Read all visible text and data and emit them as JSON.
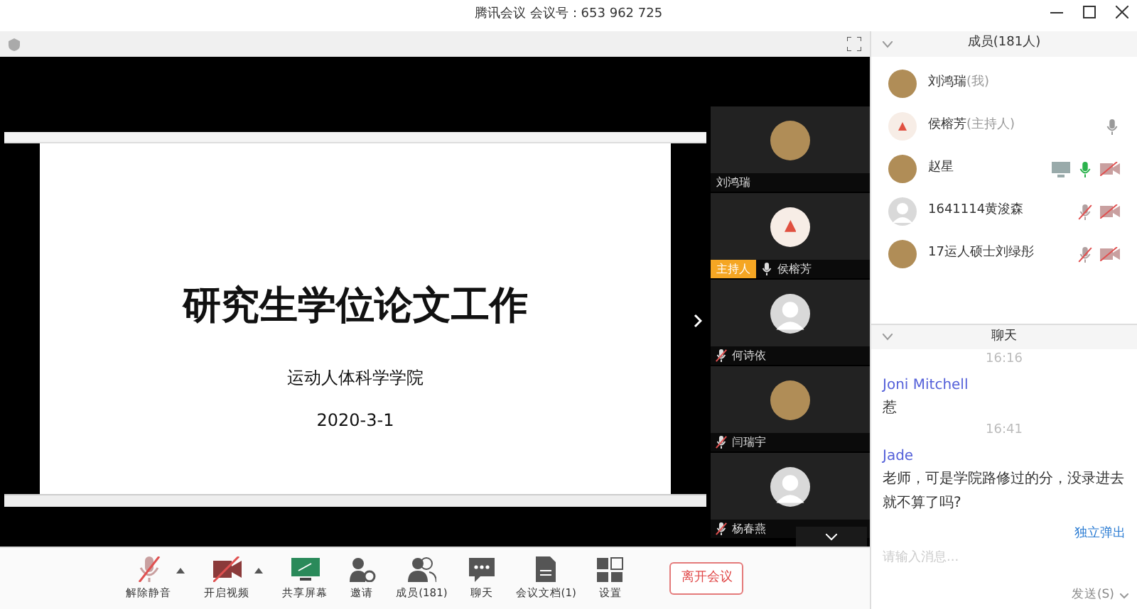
{
  "window": {
    "title": "腾讯会议 会议号：653 962 725"
  },
  "slide": {
    "title": "研究生学位论文工作",
    "subtitle": "运动人体科学学院",
    "date": "2020-3-1"
  },
  "video_tiles": [
    {
      "name": "刘鸿瑞",
      "avatar": {
        "kind": "photo"
      }
    },
    {
      "name": "侯榕芳",
      "avatar": {
        "kind": "mark"
      },
      "mic": {
        "kind": "idle"
      },
      "badge": "主持人"
    },
    {
      "name": "何诗依",
      "avatar": {
        "kind": "default"
      },
      "mic": {
        "kind": "muted"
      }
    },
    {
      "name": "闫瑞宇",
      "avatar": {
        "kind": "photo"
      },
      "mic": {
        "kind": "muted"
      }
    },
    {
      "name": "杨春燕",
      "avatar": {
        "kind": "default"
      },
      "mic": {
        "kind": "muted"
      }
    }
  ],
  "members": {
    "title": "成员(181人)",
    "items": [
      {
        "name": "刘鸿瑞",
        "tag": "(我)",
        "avatar": {
          "kind": "photo"
        },
        "sharing": false
      },
      {
        "name": "侯榕芳",
        "tag": "(主持人)",
        "avatar": {
          "kind": "mark"
        },
        "mic": {
          "kind": "idle"
        },
        "sharing": false
      },
      {
        "name": "赵星",
        "avatar": {
          "kind": "photo"
        },
        "mic": {
          "kind": "on"
        },
        "video_off": true,
        "sharing": true
      },
      {
        "name": "1641114黄浚森",
        "avatar": {
          "kind": "default"
        },
        "mic": {
          "kind": "muted"
        },
        "video_off": true,
        "sharing": false
      },
      {
        "name": "17运人硕士刘绿彤",
        "avatar": {
          "kind": "photo"
        },
        "mic": {
          "kind": "muted"
        },
        "video_off": true,
        "sharing": false
      }
    ]
  },
  "chat": {
    "title": "聊天",
    "messages": [
      {
        "kind": "time",
        "text": "16:16"
      },
      {
        "kind": "message",
        "sender": "Joni Mitchell",
        "text": "惹"
      },
      {
        "kind": "time",
        "text": "16:41"
      },
      {
        "kind": "message",
        "sender": "Jade",
        "text": "老师，可是学院路修过的分，没录进去就不算了吗?"
      }
    ],
    "popout_link": "独立弹出",
    "input": {
      "placeholder": "请输入消息..."
    },
    "send_button": "发送(S)"
  },
  "toolbar": [
    {
      "label": "解除静音",
      "kind": "mic-muted",
      "dropdown": true
    },
    {
      "label": "开启视频",
      "kind": "video-off",
      "dropdown": true
    },
    {
      "label": "共享屏幕",
      "kind": "share"
    },
    {
      "label": "邀请",
      "kind": "invite"
    },
    {
      "label": "成员(181)",
      "kind": "members"
    },
    {
      "label": "聊天",
      "kind": "chat"
    },
    {
      "label": "会议文档(1)",
      "kind": "doc"
    },
    {
      "label": "设置",
      "kind": "settings"
    }
  ],
  "leave_button": "离开会议"
}
